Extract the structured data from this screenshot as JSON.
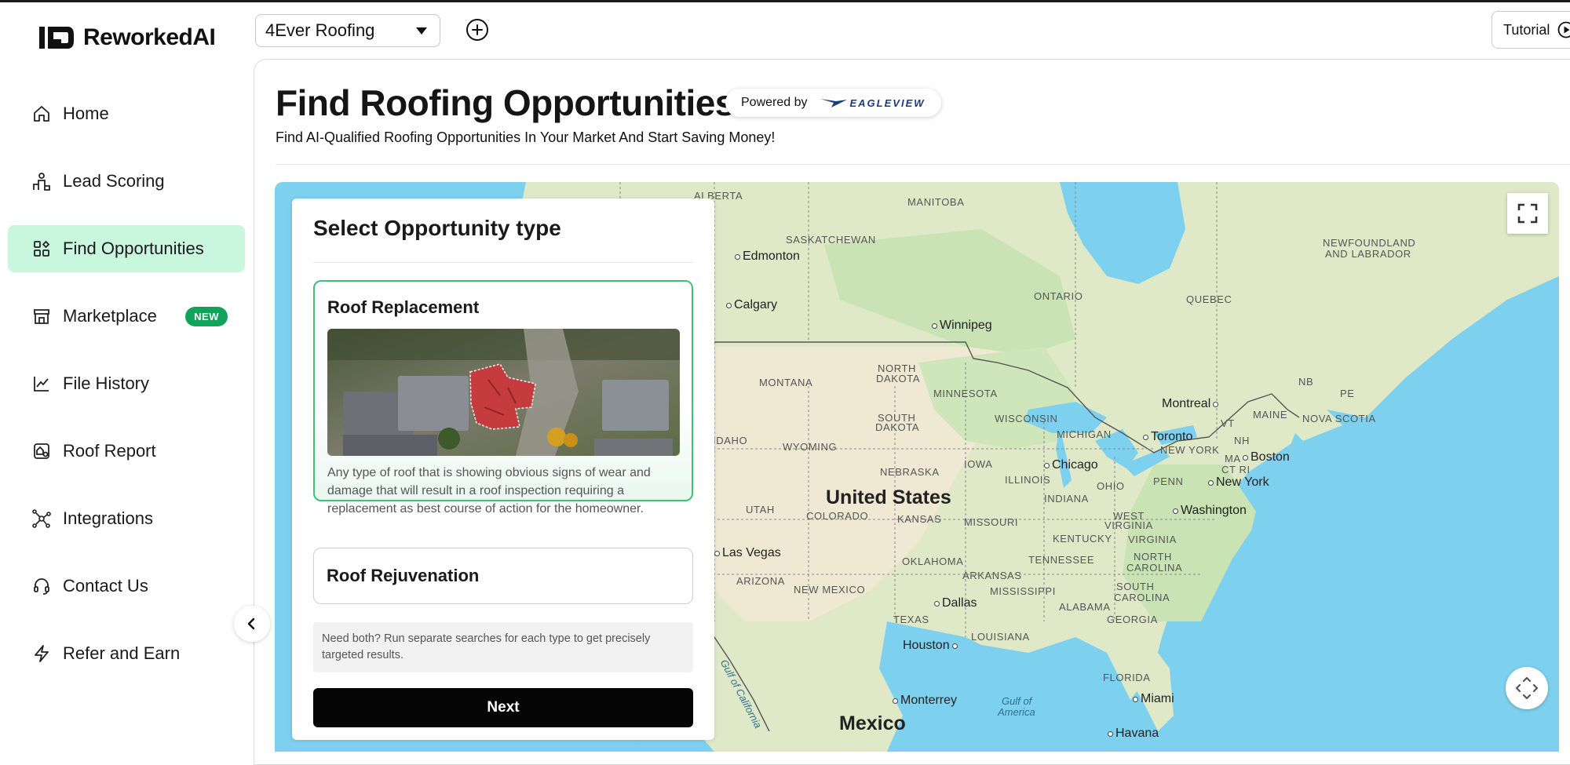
{
  "app": {
    "logo_text": "ReworkedAI"
  },
  "topbar": {
    "company": "4Ever Roofing",
    "tutorial_label": "Tutorial"
  },
  "sidebar": {
    "items": [
      {
        "label": "Home",
        "icon": "home-icon"
      },
      {
        "label": "Lead Scoring",
        "icon": "lead-scoring-icon"
      },
      {
        "label": "Find Opportunities",
        "icon": "find-opportunities-icon",
        "active": true
      },
      {
        "label": "Marketplace",
        "icon": "marketplace-icon",
        "badge": "NEW"
      },
      {
        "label": "File History",
        "icon": "file-history-icon"
      },
      {
        "label": "Roof Report",
        "icon": "roof-report-icon"
      },
      {
        "label": "Integrations",
        "icon": "integrations-icon"
      },
      {
        "label": "Contact Us",
        "icon": "contact-icon"
      },
      {
        "label": "Refer and Earn",
        "icon": "lightning-icon"
      }
    ]
  },
  "header": {
    "title": "Find Roofing Opportunities",
    "powered_by": "Powered by",
    "partner": "EAGLEVIEW",
    "subtitle": "Find AI-Qualified Roofing Opportunities In Your Market And Start Saving Money!"
  },
  "panel": {
    "title": "Select Opportunity type",
    "options": [
      {
        "name": "Roof Replacement",
        "description": "Any type of roof that is showing obvious signs of wear and damage that will result in a roof inspection requiring a replacement as best course of action for the homeowner.",
        "selected": true
      },
      {
        "name": "Roof Rejuvenation",
        "selected": false
      }
    ],
    "note": "Need both? Run separate searches for each type to get precisely targeted results.",
    "next_label": "Next"
  },
  "map": {
    "country_label": "United States",
    "mexico_label": "Mexico",
    "regions": [
      "ALBERTA",
      "MANITOBA",
      "SASKATCHEWAN",
      "ONTARIO",
      "QUEBEC",
      "NEWFOUNDLAND",
      "AND LABRADOR",
      "NORTH",
      "DAKOTA",
      "MONTANA",
      "MINNESOTA",
      "SOUTH",
      "DAKOTA",
      "WISCONSIN",
      "MICHIGAN",
      "IDAHO",
      "WYOMING",
      "NB",
      "PE",
      "MAINE",
      "NOVA SCOTIA",
      "VT",
      "NH",
      "NEW YORK",
      "MA",
      "CT RI",
      "NEBRASKA",
      "IOWA",
      "ILLINOIS",
      "INDIANA",
      "OHIO",
      "PENN",
      "UTAH",
      "COLORADO",
      "KANSAS",
      "MISSOURI",
      "WEST",
      "VIRGINIA",
      "KENTUCKY",
      "VIRGINIA",
      "TENNESSEE",
      "NORTH",
      "CAROLINA",
      "OKLAHOMA",
      "ARKANSAS",
      "ARIZONA",
      "NEW MEXICO",
      "MISSISSIPPI",
      "SOUTH",
      "CAROLINA",
      "ALABAMA",
      "GEORGIA",
      "TEXAS",
      "LOUISIANA",
      "FLORIDA"
    ],
    "cities": [
      "Edmonton",
      "Calgary",
      "Winnipeg",
      "Montreal",
      "Toronto",
      "Chicago",
      "Boston",
      "New York",
      "Washington",
      "Las Vegas",
      "Dallas",
      "Houston",
      "Monterrey",
      "Miami",
      "Havana"
    ],
    "water_labels": [
      "Gulf of",
      "America",
      "Gulf of California"
    ]
  }
}
